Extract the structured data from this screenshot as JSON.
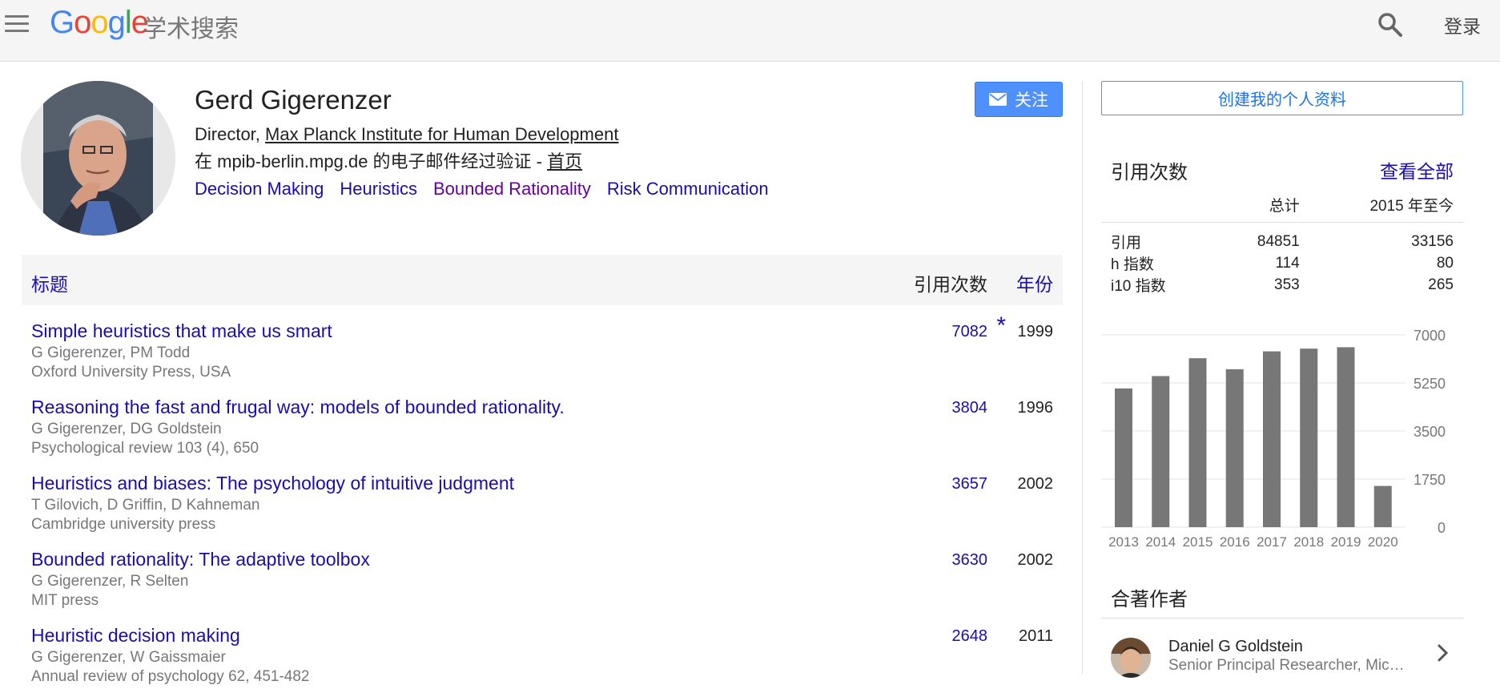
{
  "header": {
    "logo_text": "Google",
    "product": "学术搜索",
    "search_icon": "search-icon",
    "login_label": "登录"
  },
  "profile": {
    "name": "Gerd Gigerenzer",
    "title_prefix": "Director, ",
    "organization": "Max Planck Institute for Human Development",
    "email_text": "在 mpib-berlin.mpg.de 的电子邮件经过验证 - ",
    "homepage_label": "首页",
    "interests": [
      "Decision Making",
      "Heuristics",
      "Bounded Rationality",
      "Risk Communication"
    ],
    "follow_label": "关注"
  },
  "publications": {
    "headers": {
      "title": "标题",
      "cites": "引用次数",
      "year": "年份"
    },
    "star": "*",
    "items": [
      {
        "title": "Simple heuristics that make us smart",
        "authors": "G Gigerenzer, PM Todd",
        "venue": "Oxford University Press, USA",
        "cites": "7082",
        "year": "1999"
      },
      {
        "title": "Reasoning the fast and frugal way: models of bounded rationality.",
        "authors": "G Gigerenzer, DG Goldstein",
        "venue": "Psychological review 103 (4), 650",
        "cites": "3804",
        "year": "1996"
      },
      {
        "title": "Heuristics and biases: The psychology of intuitive judgment",
        "authors": "T Gilovich, D Griffin, D Kahneman",
        "venue": "Cambridge university press",
        "cites": "3657",
        "year": "2002"
      },
      {
        "title": "Bounded rationality: The adaptive toolbox",
        "authors": "G Gigerenzer, R Selten",
        "venue": "MIT press",
        "cites": "3630",
        "year": "2002"
      },
      {
        "title": "Heuristic decision making",
        "authors": "G Gigerenzer, W Gaissmaier",
        "venue": "Annual review of psychology 62, 451-482",
        "cites": "2648",
        "year": "2011"
      }
    ]
  },
  "sidebar": {
    "create_profile_label": "创建我的个人资料",
    "citations_title": "引用次数",
    "view_all_label": "查看全部",
    "col_total": "总计",
    "col_since": "2015 年至今",
    "rows": [
      {
        "label": "引用",
        "total": "84851",
        "since": "33156"
      },
      {
        "label": "h 指数",
        "total": "114",
        "since": "80"
      },
      {
        "label": "i10 指数",
        "total": "353",
        "since": "265"
      }
    ],
    "coauthors_title": "合著作者",
    "coauthor": {
      "name": "Daniel G Goldstein",
      "affiliation": "Senior Principal Researcher, Mic…"
    }
  },
  "chart_data": {
    "type": "bar",
    "categories": [
      "2013",
      "2014",
      "2015",
      "2016",
      "2017",
      "2018",
      "2019",
      "2020"
    ],
    "values": [
      5050,
      5500,
      6150,
      5750,
      6400,
      6500,
      6550,
      1500
    ],
    "ylim": [
      0,
      7000
    ],
    "yticks": [
      0,
      1750,
      3500,
      5250,
      7000
    ],
    "bar_color": "#777777",
    "grid": true
  }
}
